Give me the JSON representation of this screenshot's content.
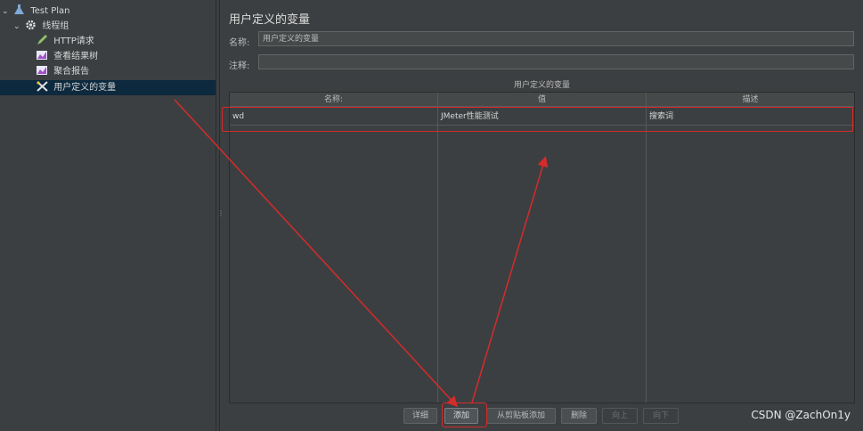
{
  "tree": {
    "items": [
      {
        "label": "Test Plan",
        "icon": "flask-icon"
      },
      {
        "label": "线程组",
        "icon": "gear-icon"
      },
      {
        "label": "HTTP请求",
        "icon": "pen-icon"
      },
      {
        "label": "查看结果树",
        "icon": "chart-icon"
      },
      {
        "label": "聚合报告",
        "icon": "chart-icon"
      },
      {
        "label": "用户定义的变量",
        "icon": "tools-icon"
      }
    ]
  },
  "panel": {
    "title": "用户定义的变量",
    "name_label": "名称:",
    "name_value": "用户定义的变量",
    "comment_label": "注释:",
    "comment_value": "",
    "table_caption": "用户定义的变量"
  },
  "table": {
    "columns": [
      "名称:",
      "值",
      "描述"
    ],
    "rows": [
      [
        "wd",
        "JMeter性能测试",
        "搜索词"
      ]
    ]
  },
  "buttons": {
    "detail": "详细",
    "add": "添加",
    "add_clipboard": "从剪贴板添加",
    "delete": "删除",
    "up": "向上",
    "down": "向下"
  },
  "watermark": "CSDN @ZachOn1y",
  "colors": {
    "background": "#3c3f41",
    "selection": "#0d293e",
    "annotation": "#d42b2b"
  }
}
